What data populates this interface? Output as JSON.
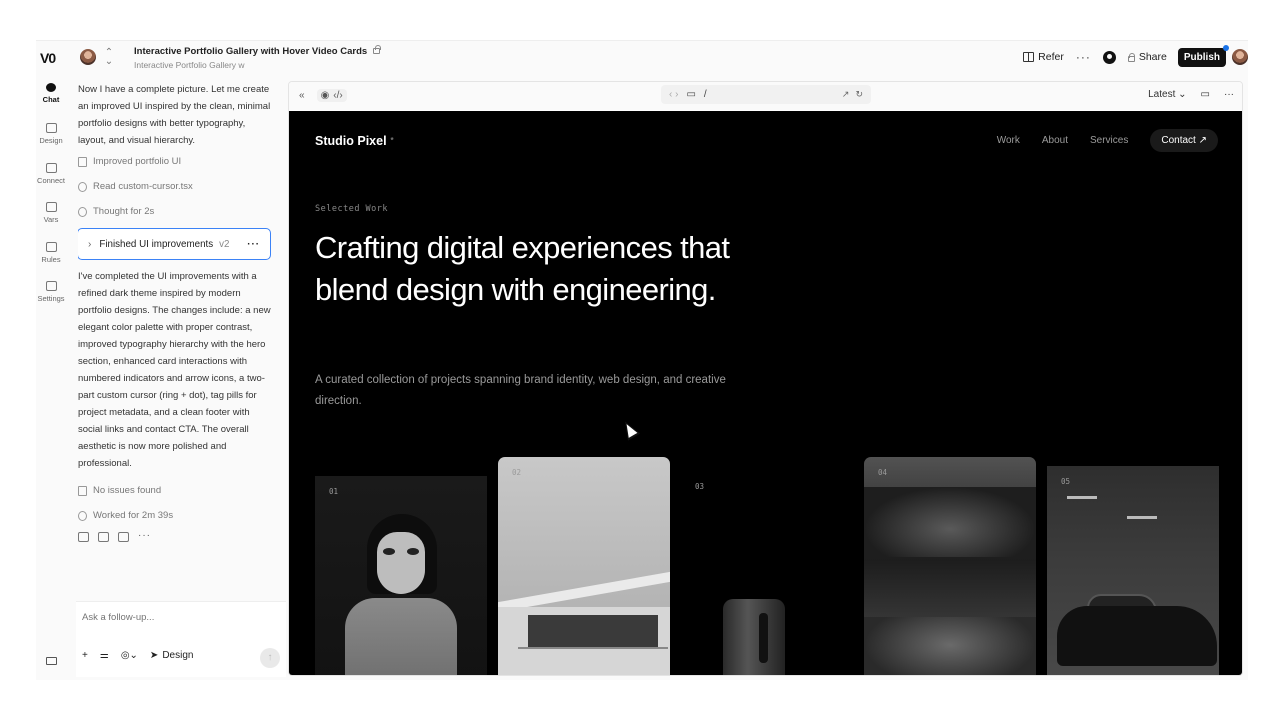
{
  "topbar": {
    "logo": "V0",
    "project_title": "Interactive Portfolio Gallery with Hover Video Cards",
    "project_subtitle": "Interactive Portfolio Gallery w",
    "refer": "Refer",
    "share": "Share",
    "publish": "Publish"
  },
  "rail": {
    "items": [
      {
        "label": "Chat",
        "icon": "chat-icon"
      },
      {
        "label": "Design",
        "icon": "design-icon"
      },
      {
        "label": "Connect",
        "icon": "connect-icon"
      },
      {
        "label": "Vars",
        "icon": "vars-icon"
      },
      {
        "label": "Rules",
        "icon": "rules-icon"
      },
      {
        "label": "Settings",
        "icon": "gear-icon"
      }
    ]
  },
  "chat": {
    "intro": "Now I have a complete picture. Let me create an improved UI inspired by the clean, minimal portfolio designs with better typography, layout, and visual hierarchy.",
    "steps": [
      {
        "label": "Improved portfolio UI",
        "icon": "file-icon"
      },
      {
        "label": "Read custom-cursor.tsx",
        "icon": "search-icon"
      },
      {
        "label": "Thought for 2s",
        "icon": "brain-icon"
      }
    ],
    "version_card": {
      "label": "Finished UI improvements",
      "version": "v2"
    },
    "summary": "I've completed the UI improvements with a refined dark theme inspired by modern portfolio designs. The changes include: a new elegant color palette with proper contrast, improved typography hierarchy with the hero section, enhanced card interactions with numbered indicators and arrow icons, a two-part custom cursor (ring + dot), tag pills for project metadata, and a clean footer with social links and contact CTA. The overall aesthetic is now more polished and professional.",
    "status_issues": "No issues found",
    "status_worked": "Worked for 2m 39s"
  },
  "composer": {
    "placeholder": "Ask a follow-up...",
    "design_label": "Design"
  },
  "preview_toolbar": {
    "url": "/",
    "version_label": "Latest"
  },
  "site": {
    "brand": "Studio Pixel",
    "brand_mark": "*",
    "nav": [
      "Work",
      "About",
      "Services"
    ],
    "contact": "Contact",
    "eyebrow": "Selected Work",
    "hero": "Crafting digital experiences that blend design with engineering.",
    "lede": "A curated collection of projects spanning brand identity, web design, and creative direction.",
    "cards": [
      {
        "number": "01"
      },
      {
        "number": "02"
      },
      {
        "number": "03"
      },
      {
        "number": "04"
      },
      {
        "number": "05"
      }
    ]
  }
}
